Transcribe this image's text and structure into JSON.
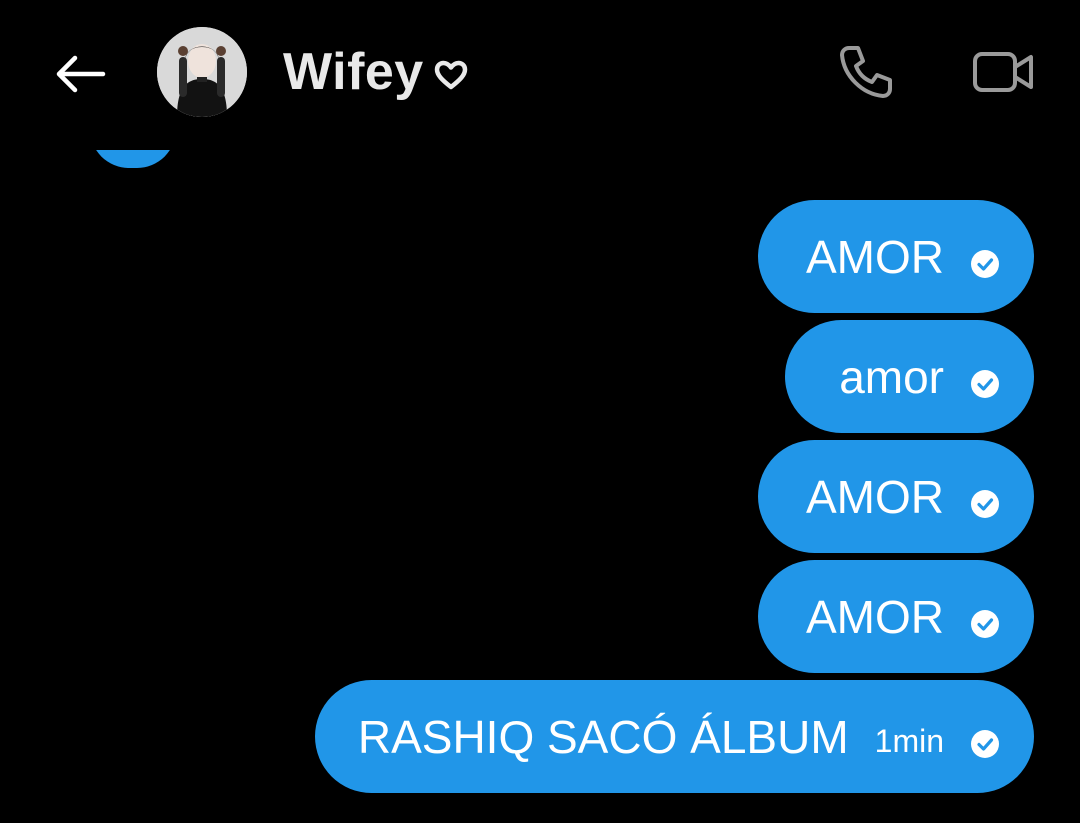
{
  "header": {
    "title": "Wifey",
    "back_icon": "arrow-left-icon",
    "heart_icon": "heart-outline-icon",
    "call_icon": "phone-icon",
    "video_icon": "video-camera-icon"
  },
  "colors": {
    "background": "#000000",
    "bubble": "#2196e8",
    "text": "#ffffff",
    "header_icons": "#9a9a9a"
  },
  "messages": [
    {
      "text": "AMOR",
      "time": "",
      "status_icon": "check-circle-icon"
    },
    {
      "text": "amor",
      "time": "",
      "status_icon": "check-circle-icon"
    },
    {
      "text": "AMOR",
      "time": "",
      "status_icon": "check-circle-icon"
    },
    {
      "text": "AMOR",
      "time": "",
      "status_icon": "check-circle-icon"
    },
    {
      "text": "RASHIQ SACÓ ÁLBUM",
      "time": "1min",
      "status_icon": "check-circle-icon"
    }
  ]
}
